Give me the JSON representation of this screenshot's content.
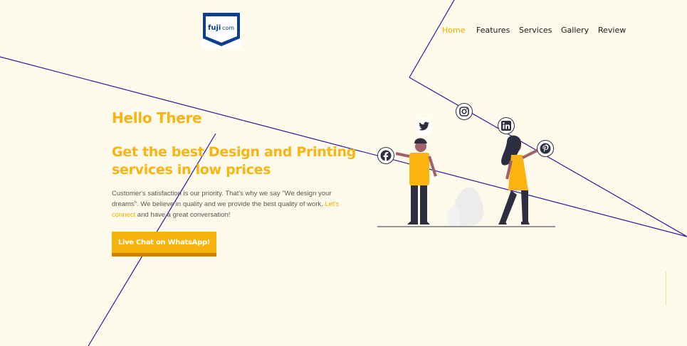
{
  "brand": {
    "logo_text": "fujicom",
    "logo_color": "#0b3d91"
  },
  "nav": {
    "items": [
      {
        "label": "Home",
        "active": true
      },
      {
        "label": "Features",
        "active": false
      },
      {
        "label": "Services",
        "active": false
      },
      {
        "label": "Gallery",
        "active": false
      },
      {
        "label": "Review",
        "active": false
      }
    ]
  },
  "hero": {
    "greeting": "Hello There",
    "headline": "Get the best Design and Printing services in low prices",
    "description_before": "Customer's satisfaction is our priority. That's why we say \"We design your dreams\". We believe in quality and we provide the best quality of work. ",
    "description_link": "Let's connect",
    "description_after": " and have a great conversation!",
    "cta_label": "Live Chat on WhatsApp!"
  },
  "social_icons": [
    "twitter-icon",
    "instagram-icon",
    "linkedin-icon",
    "pinterest-icon",
    "facebook-icon"
  ],
  "colors": {
    "background": "#fffbec",
    "accent": "#fbb40f",
    "cta_shadow": "#d67e00",
    "line": "#2a1a9c",
    "figure_dark": "#2f2e41"
  }
}
